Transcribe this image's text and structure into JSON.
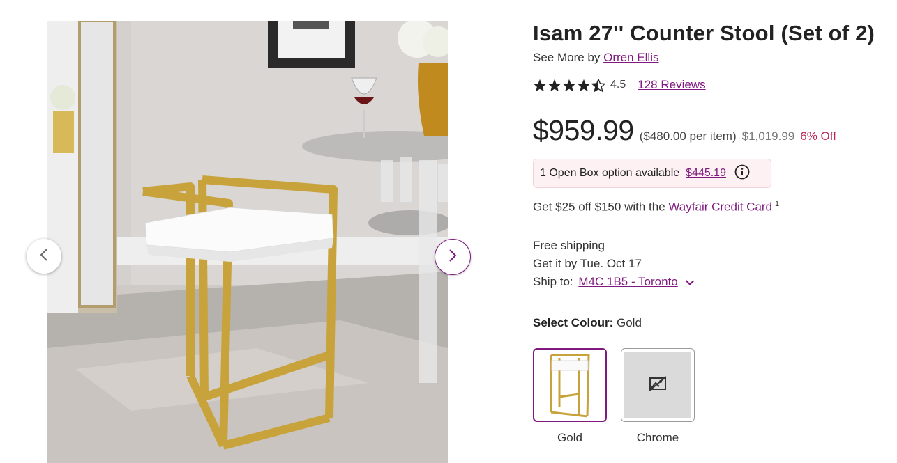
{
  "product": {
    "title": "Isam 27'' Counter Stool (Set of 2)",
    "see_more_prefix": "See More by",
    "brand": "Orren Ellis",
    "rating": 4.5,
    "rating_text": "4.5",
    "reviews_label": "128 Reviews"
  },
  "pricing": {
    "price": "$959.99",
    "per_item": "($480.00 per item)",
    "original_price": "$1,019.99",
    "discount": "6% Off"
  },
  "open_box": {
    "text": "1 Open Box option available",
    "price": "$445.19",
    "icon": "info-icon"
  },
  "promo": {
    "text": "Get $25 off $150 with the",
    "link": "Wayfair Credit Card",
    "footnote": "1"
  },
  "shipping": {
    "free": "Free shipping",
    "delivery": "Get it by Tue. Oct 17",
    "ship_to_label": "Ship to:",
    "ship_to_value": "M4C 1B5 - Toronto",
    "icon": "chevron-down-icon"
  },
  "colour": {
    "label": "Select Colour:",
    "selected": "Gold",
    "options": [
      {
        "name": "Gold",
        "selected": true
      },
      {
        "name": "Chrome",
        "selected": false
      }
    ]
  },
  "gallery": {
    "prev_icon": "chevron-left-icon",
    "next_icon": "chevron-right-icon"
  },
  "colors": {
    "accent": "#7f187f",
    "discount": "#b8265a",
    "openbox_bg": "#fdf1f3",
    "star": "#222222"
  }
}
